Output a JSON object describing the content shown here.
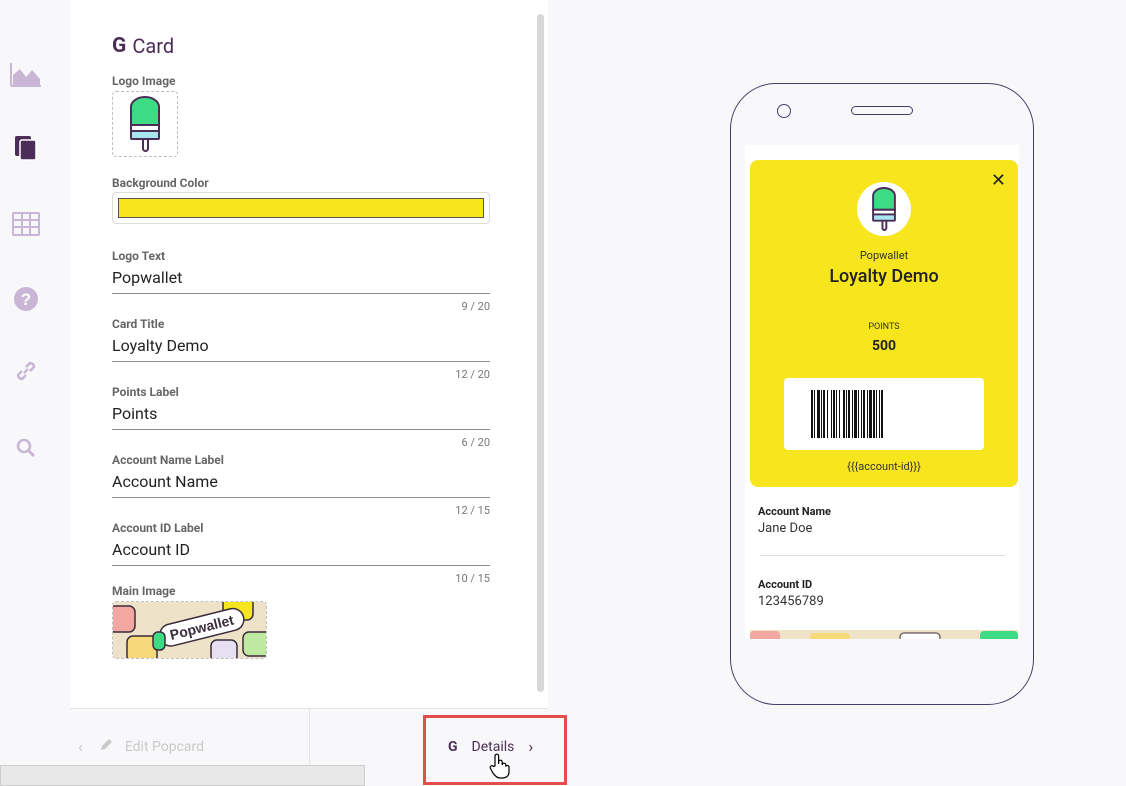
{
  "rail": {
    "icons": [
      "analytics-icon",
      "cards-icon",
      "table-icon",
      "help-icon",
      "link-icon",
      "search-icon"
    ]
  },
  "editor": {
    "title_glyph": "G",
    "title": "Card",
    "fields": {
      "logo_image_label": "Logo Image",
      "background_color_label": "Background Color",
      "background_color": "#f7e51d",
      "logo_text_label": "Logo Text",
      "logo_text_value": "Popwallet",
      "logo_text_count": "9 / 20",
      "card_title_label": "Card Title",
      "card_title_value": "Loyalty Demo",
      "card_title_count": "12 / 20",
      "points_label_label": "Points Label",
      "points_label_value": "Points",
      "points_label_count": "6 / 20",
      "account_name_label_label": "Account Name Label",
      "account_name_label_value": "Account Name",
      "account_name_label_count": "12 / 15",
      "account_id_label_label": "Account ID Label",
      "account_id_label_value": "Account ID",
      "account_id_label_count": "10 / 15",
      "main_image_label": "Main Image",
      "main_image_text": "Popwallet"
    }
  },
  "footer": {
    "prev_chevron": "‹",
    "prev_label": "Edit Popcard",
    "next_glyph": "G",
    "next_label": "Details",
    "next_chevron": "›"
  },
  "preview": {
    "close": "✕",
    "logo_text": "Popwallet",
    "card_title": "Loyalty Demo",
    "points_label": "POINTS",
    "points_value": "500",
    "account_id_template": "{{{account-id}}}",
    "account_name_label": "Account Name",
    "account_name_value": "Jane Doe",
    "account_id_label": "Account ID",
    "account_id_value": "123456789"
  },
  "colors": {
    "brand": "#4b2d57",
    "card_bg": "#f7e51d",
    "highlight": "#e74c4c",
    "popsicle_top": "#3ddc84",
    "popsicle_mid": "#a8e6ef"
  }
}
